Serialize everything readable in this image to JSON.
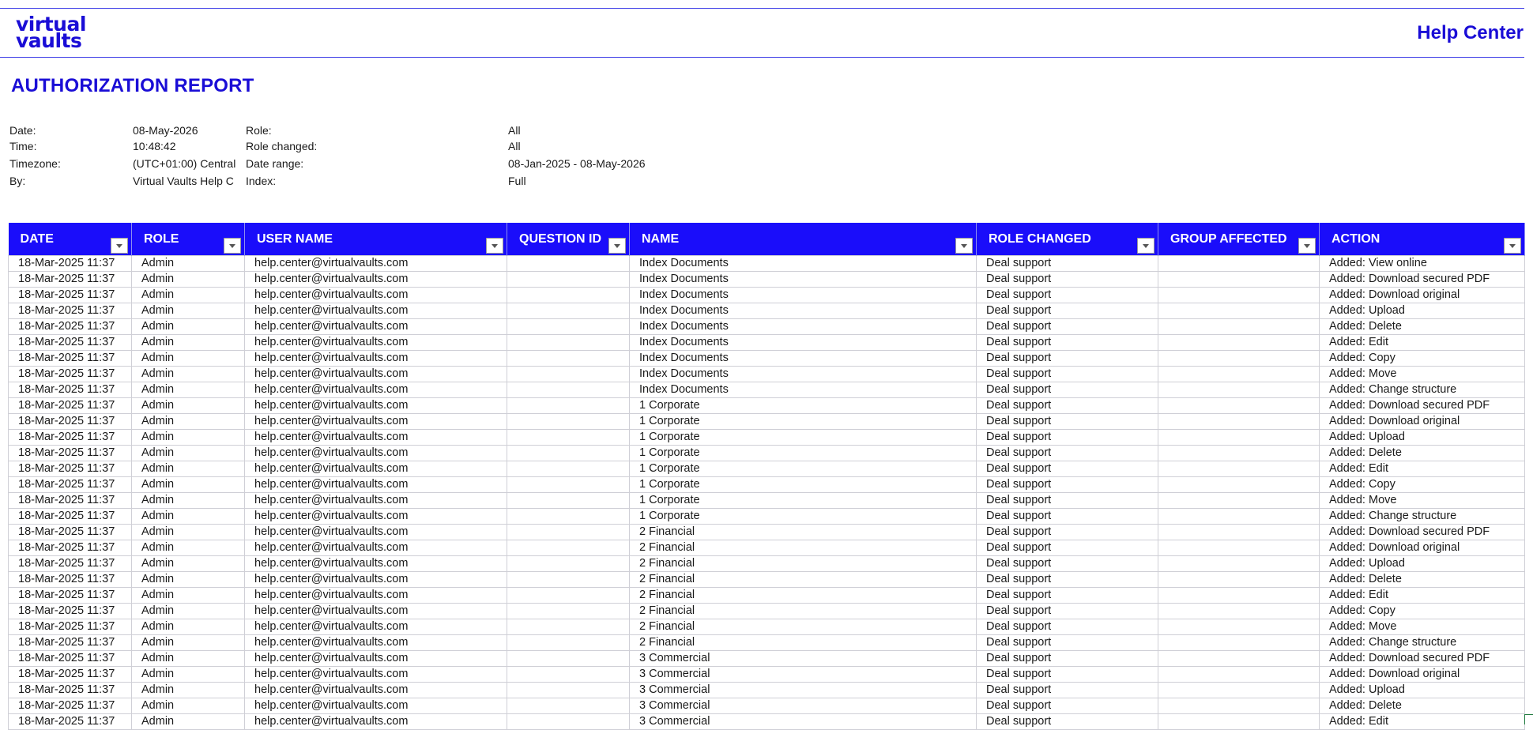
{
  "header": {
    "logo_line1": "virtual",
    "logo_line2": "vaults",
    "help_center": "Help Center"
  },
  "report": {
    "title": "AUTHORIZATION REPORT",
    "date_label": "Date:",
    "date_value": "08-May-2026",
    "time_label": "Time:",
    "time_value": "10:48:42",
    "timezone_label": "Timezone:",
    "timezone_value": "(UTC+01:00) Central",
    "by_label": "By:",
    "by_value": "Virtual Vaults Help C",
    "role_label": "Role:",
    "role_value": "All",
    "role_changed_label": "Role changed:",
    "role_changed_value": "All",
    "date_range_label": "Date range:",
    "date_range_value": "08-Jan-2025 - 08-May-2026",
    "index_label": "Index:",
    "index_value": "Full"
  },
  "table": {
    "columns": [
      "DATE",
      "ROLE",
      "USER NAME",
      "QUESTION ID",
      "NAME",
      "ROLE CHANGED",
      "GROUP AFFECTED",
      "ACTION"
    ],
    "rows": [
      [
        "18-Mar-2025 11:37",
        "Admin",
        "help.center@virtualvaults.com",
        "",
        "Index Documents",
        "Deal support",
        "",
        "Added: View online"
      ],
      [
        "18-Mar-2025 11:37",
        "Admin",
        "help.center@virtualvaults.com",
        "",
        "Index Documents",
        "Deal support",
        "",
        "Added: Download secured PDF"
      ],
      [
        "18-Mar-2025 11:37",
        "Admin",
        "help.center@virtualvaults.com",
        "",
        "Index Documents",
        "Deal support",
        "",
        "Added: Download original"
      ],
      [
        "18-Mar-2025 11:37",
        "Admin",
        "help.center@virtualvaults.com",
        "",
        "Index Documents",
        "Deal support",
        "",
        "Added: Upload"
      ],
      [
        "18-Mar-2025 11:37",
        "Admin",
        "help.center@virtualvaults.com",
        "",
        "Index Documents",
        "Deal support",
        "",
        "Added: Delete"
      ],
      [
        "18-Mar-2025 11:37",
        "Admin",
        "help.center@virtualvaults.com",
        "",
        "Index Documents",
        "Deal support",
        "",
        "Added: Edit"
      ],
      [
        "18-Mar-2025 11:37",
        "Admin",
        "help.center@virtualvaults.com",
        "",
        "Index Documents",
        "Deal support",
        "",
        "Added: Copy"
      ],
      [
        "18-Mar-2025 11:37",
        "Admin",
        "help.center@virtualvaults.com",
        "",
        "Index Documents",
        "Deal support",
        "",
        "Added: Move"
      ],
      [
        "18-Mar-2025 11:37",
        "Admin",
        "help.center@virtualvaults.com",
        "",
        "Index Documents",
        "Deal support",
        "",
        "Added: Change structure"
      ],
      [
        "18-Mar-2025 11:37",
        "Admin",
        "help.center@virtualvaults.com",
        "",
        "1 Corporate",
        "Deal support",
        "",
        "Added: Download secured PDF"
      ],
      [
        "18-Mar-2025 11:37",
        "Admin",
        "help.center@virtualvaults.com",
        "",
        "1 Corporate",
        "Deal support",
        "",
        "Added: Download original"
      ],
      [
        "18-Mar-2025 11:37",
        "Admin",
        "help.center@virtualvaults.com",
        "",
        "1 Corporate",
        "Deal support",
        "",
        "Added: Upload"
      ],
      [
        "18-Mar-2025 11:37",
        "Admin",
        "help.center@virtualvaults.com",
        "",
        "1 Corporate",
        "Deal support",
        "",
        "Added: Delete"
      ],
      [
        "18-Mar-2025 11:37",
        "Admin",
        "help.center@virtualvaults.com",
        "",
        "1 Corporate",
        "Deal support",
        "",
        "Added: Edit"
      ],
      [
        "18-Mar-2025 11:37",
        "Admin",
        "help.center@virtualvaults.com",
        "",
        "1 Corporate",
        "Deal support",
        "",
        "Added: Copy"
      ],
      [
        "18-Mar-2025 11:37",
        "Admin",
        "help.center@virtualvaults.com",
        "",
        "1 Corporate",
        "Deal support",
        "",
        "Added: Move"
      ],
      [
        "18-Mar-2025 11:37",
        "Admin",
        "help.center@virtualvaults.com",
        "",
        "1 Corporate",
        "Deal support",
        "",
        "Added: Change structure"
      ],
      [
        "18-Mar-2025 11:37",
        "Admin",
        "help.center@virtualvaults.com",
        "",
        "2 Financial",
        "Deal support",
        "",
        "Added: Download secured PDF"
      ],
      [
        "18-Mar-2025 11:37",
        "Admin",
        "help.center@virtualvaults.com",
        "",
        "2 Financial",
        "Deal support",
        "",
        "Added: Download original"
      ],
      [
        "18-Mar-2025 11:37",
        "Admin",
        "help.center@virtualvaults.com",
        "",
        "2 Financial",
        "Deal support",
        "",
        "Added: Upload"
      ],
      [
        "18-Mar-2025 11:37",
        "Admin",
        "help.center@virtualvaults.com",
        "",
        "2 Financial",
        "Deal support",
        "",
        "Added: Delete"
      ],
      [
        "18-Mar-2025 11:37",
        "Admin",
        "help.center@virtualvaults.com",
        "",
        "2 Financial",
        "Deal support",
        "",
        "Added: Edit"
      ],
      [
        "18-Mar-2025 11:37",
        "Admin",
        "help.center@virtualvaults.com",
        "",
        "2 Financial",
        "Deal support",
        "",
        "Added: Copy"
      ],
      [
        "18-Mar-2025 11:37",
        "Admin",
        "help.center@virtualvaults.com",
        "",
        "2 Financial",
        "Deal support",
        "",
        "Added: Move"
      ],
      [
        "18-Mar-2025 11:37",
        "Admin",
        "help.center@virtualvaults.com",
        "",
        "2 Financial",
        "Deal support",
        "",
        "Added: Change structure"
      ],
      [
        "18-Mar-2025 11:37",
        "Admin",
        "help.center@virtualvaults.com",
        "",
        "3 Commercial",
        "Deal support",
        "",
        "Added: Download secured PDF"
      ],
      [
        "18-Mar-2025 11:37",
        "Admin",
        "help.center@virtualvaults.com",
        "",
        "3 Commercial",
        "Deal support",
        "",
        "Added: Download original"
      ],
      [
        "18-Mar-2025 11:37",
        "Admin",
        "help.center@virtualvaults.com",
        "",
        "3 Commercial",
        "Deal support",
        "",
        "Added: Upload"
      ],
      [
        "18-Mar-2025 11:37",
        "Admin",
        "help.center@virtualvaults.com",
        "",
        "3 Commercial",
        "Deal support",
        "",
        "Added: Delete"
      ],
      [
        "18-Mar-2025 11:37",
        "Admin",
        "help.center@virtualvaults.com",
        "",
        "3 Commercial",
        "Deal support",
        "",
        "Added: Edit"
      ]
    ]
  }
}
